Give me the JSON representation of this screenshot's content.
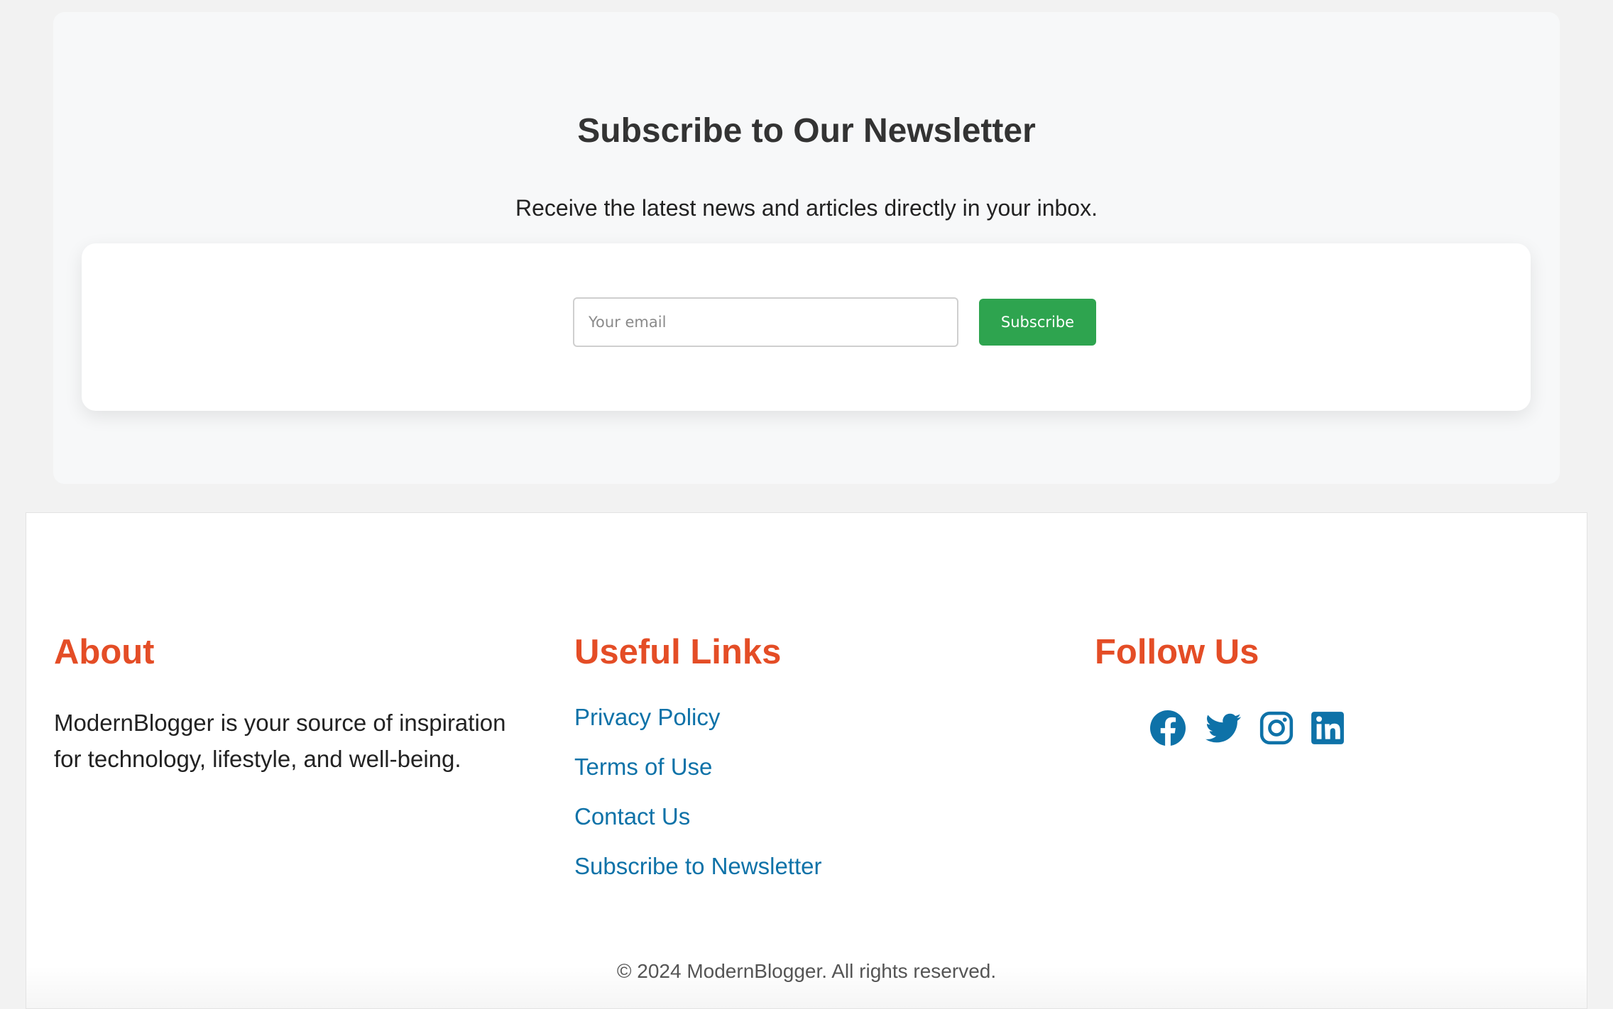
{
  "newsletter": {
    "title": "Subscribe to Our Newsletter",
    "subtitle": "Receive the latest news and articles directly in your inbox.",
    "email_placeholder": "Your email",
    "email_value": "",
    "subscribe_label": "Subscribe"
  },
  "footer": {
    "about": {
      "heading": "About",
      "text": "ModernBlogger is your source of inspiration for technology, lifestyle, and well-being."
    },
    "links": {
      "heading": "Useful Links",
      "items": [
        {
          "label": "Privacy Policy"
        },
        {
          "label": "Terms of Use"
        },
        {
          "label": "Contact Us"
        },
        {
          "label": "Subscribe to Newsletter"
        }
      ]
    },
    "follow": {
      "heading": "Follow Us",
      "icons": [
        "facebook-icon",
        "twitter-icon",
        "instagram-icon",
        "linkedin-icon"
      ]
    },
    "copyright": "© 2024 ModernBlogger. All rights reserved."
  },
  "colors": {
    "accent_heading": "#e44d26",
    "link": "#0e72a8",
    "button": "#2ea44f"
  }
}
